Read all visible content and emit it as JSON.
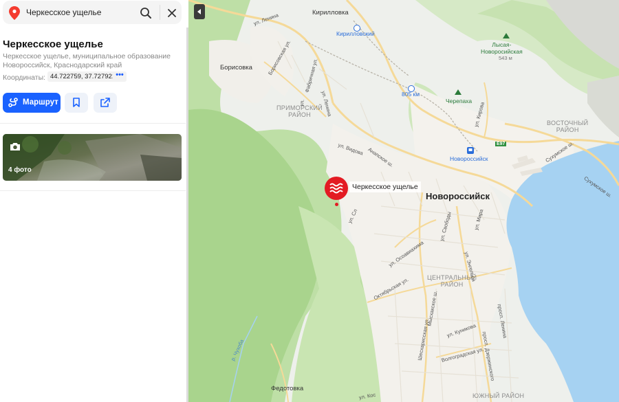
{
  "search": {
    "query": "Черкесское ущелье",
    "icons": [
      "location-pin-icon",
      "search-icon",
      "close-icon"
    ]
  },
  "place": {
    "title": "Черкесское ущелье",
    "subtitle": "Черкесское ущелье, муниципальное образование Новороссийск, Краснодарский край",
    "coords_label": "Координаты:",
    "coords_value": "44.722759, 37.727921",
    "coords_more": "•••"
  },
  "actions": {
    "route_label": "Маршрут"
  },
  "photos": {
    "count_label": "4 фото"
  },
  "map": {
    "marker_label": "Черкесское ущелье",
    "city": "Новороссийск",
    "towns": {
      "kirillovka": "Кирилловка",
      "borisovka": "Борисовка",
      "fedotovka": "Федотовка",
      "lysaya": "Лысая-\nНоворосийская",
      "lysaya_height": "543 м",
      "cherepakha": "Черепаха"
    },
    "stations": {
      "kirillovsky": "Кирилловский",
      "km805": "805 км",
      "novorossiysk": "Новороссийск"
    },
    "districts": {
      "primorsky": "ПРИМОРСКИЙ\nРАЙОН",
      "vostochny": "ВОСТОЧНЫЙ\nРАЙОН",
      "centralny": "ЦЕНТРАЛЬНЫЙ\nРАЙОН",
      "yuzhny": "ЮЖНЫЙ РАЙОН"
    },
    "road_badge": "E97",
    "streets": {
      "lenina_top": "ул. Ленина",
      "borisovskaya": "Борисовская ул.",
      "fabrichnaya": "Фабричная ул.",
      "lenina2": "ул. Ленина",
      "vidova": "ул. Видова",
      "anapskoe": "Анапское ш.",
      "kirova": "ул. Кирова",
      "sukhumskoe": "Сухумское ш.",
      "sukhumskoe2": "Сухумское ш.",
      "mira": "ул. Мира",
      "svobody": "ул. Свободы",
      "engelsa": "ул. Энгельса",
      "osoaviakhima": "ул. Осоавиахима",
      "oktyabrskaya": "Октябрьская ул.",
      "myskhakskoe": "Мысхакское ш.",
      "kunikova": "ул. Куникова",
      "lenina_pr": "просп. Ленина",
      "dzerzhinskogo": "просп. Дзержинского",
      "volgogradskaya": "Волгоградская ул.",
      "sheskharis": "Шесхарисская ул.",
      "chukhoba": "р. Чухоба",
      "slav": "ул. Сл",
      "ul_top": "ул.",
      "ul_kos": "ул. Кос"
    }
  }
}
